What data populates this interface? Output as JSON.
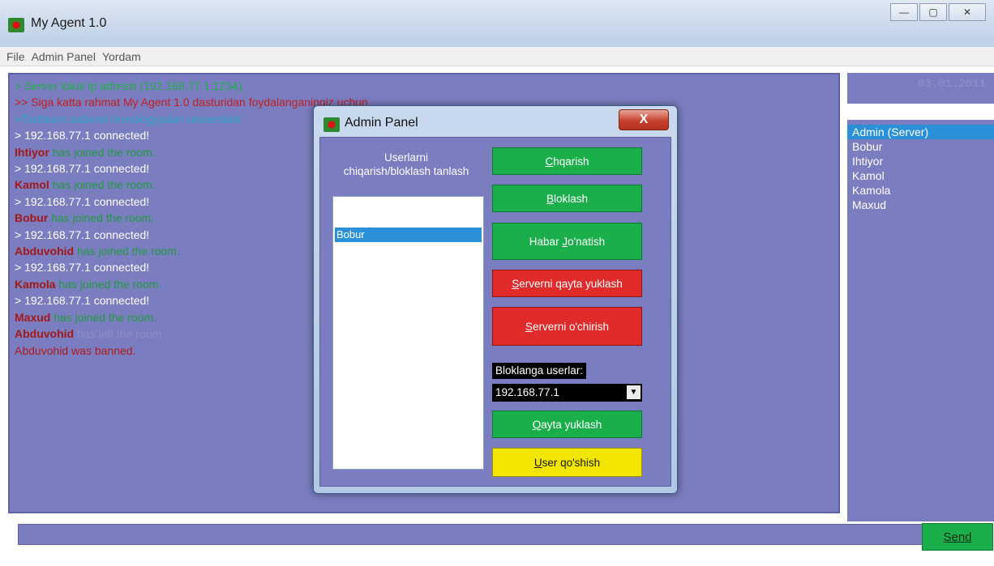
{
  "window": {
    "title": "My Agent 1.0",
    "min_symbol": "—",
    "max_symbol": "▢",
    "close_symbol": "✕"
  },
  "menu": {
    "items": [
      "File",
      "Admin Panel",
      "Yordam"
    ]
  },
  "chat_log": {
    "lines": [
      "> Server lokal Ip adressi (192.168.77.1:1234).",
      ">> Siga katta rahmat My Agent 1.0 dasturidan foydalanganingiz uchun",
      ">Toshkent axborot texnologiyalari universiteti",
      "> 192.168.77.1 connected!",
      {
        "name": "Ihtiyor",
        "rest": " has joined the room."
      },
      "> 192.168.77.1 connected!",
      {
        "name": "Kamol",
        "rest": " has joined the room."
      },
      "> 192.168.77.1 connected!",
      {
        "name": "Bobur",
        "rest": " has joined the room."
      },
      "> 192.168.77.1 connected!",
      {
        "name": "Abduvohid",
        "rest": " has joined the room."
      },
      "> 192.168.77.1 connected!",
      {
        "name": "Kamola",
        "rest": " has joined the room."
      },
      "> 192.168.77.1 connected!",
      {
        "name": "Maxud",
        "rest": " has joined the room."
      },
      {
        "name": "Abduvohid",
        "rest": " has left the room."
      },
      "Abduvohid was banned."
    ]
  },
  "right_panel": {
    "date": "03.01.2011",
    "users": [
      "Admin (Server)",
      "Bobur",
      "Ihtiyor",
      "Kamol",
      "Kamola",
      "Maxud"
    ],
    "selected_index": 0
  },
  "send_label": "Send",
  "dialog": {
    "title": "Admin Panel",
    "close_symbol": "X",
    "section_label_line1": "Userlarni",
    "section_label_line2": "chiqarish/bloklash tanlash",
    "list_items": [
      "Bobur"
    ],
    "buttons": {
      "chiqarish_ul": "C",
      "chiqarish_rest": "hqarish",
      "bloklash_ul": "B",
      "bloklash_rest": "loklash",
      "habar_pre": "Habar ",
      "habar_ul": "J",
      "habar_rest": "o'natish",
      "qayta_server_ul": "S",
      "qayta_server_rest": "erverni qayta yuklash",
      "ochirish_ul": "S",
      "ochirish_rest": "erverni o'chirish",
      "qayta_yuklash_ul": "Q",
      "qayta_yuklash_rest": "ayta yuklash",
      "user_qoshish_ul": "U",
      "user_qoshish_rest": "ser qo'shish"
    },
    "blocked_label": "Bloklanga userlar:",
    "blocked_selected": "192.168.77.1",
    "select_arrow": "▼"
  }
}
